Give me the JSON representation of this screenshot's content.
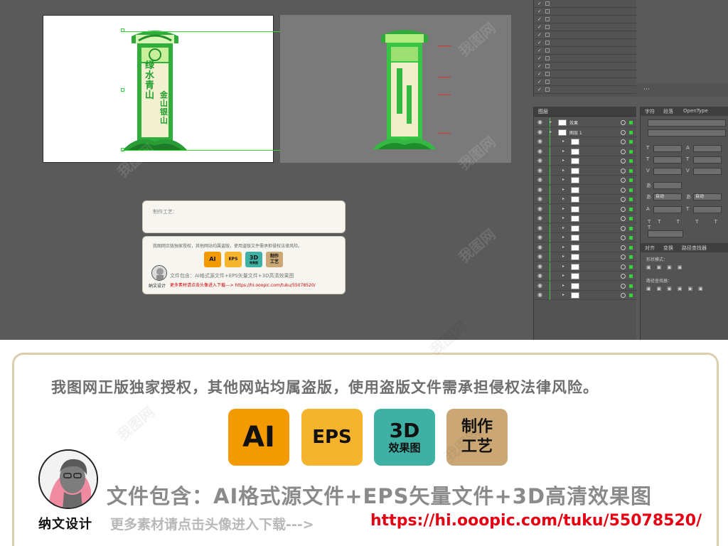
{
  "artboard": {
    "left_sign": {
      "line1": "绿水青山",
      "line2": "金山银山"
    },
    "right_annotations": [
      "",
      "",
      "",
      ""
    ]
  },
  "preview": {
    "craft_title": "制作工艺：",
    "craft_lines": [
      "",
      "",
      ""
    ],
    "promo_notice": "我图网正版独家授权，其他网站均属盗版，使用盗版文件需承担侵权法律风险。",
    "badges": [
      "AI",
      "EPS",
      "3D",
      "效果图",
      "制作",
      "工艺"
    ],
    "includes": "文件包含：AI格式源文件+EPS矢量文件+3D高清效果图",
    "author": "纳文设计",
    "more": "更多素材请点击头像进入下载---> https://hi.ooopic.com/tuku/55078520/"
  },
  "layers_top": {
    "rows": [
      "",
      "",
      "",
      "",
      "",
      "",
      "",
      "",
      "",
      "",
      "",
      ""
    ]
  },
  "layers_panel": {
    "tab": "图层",
    "rows": [
      "效果",
      "图层 1",
      "",
      "",
      "",
      "",
      "",
      "",
      "",
      "",
      "",
      "",
      "",
      "",
      "",
      "",
      "",
      "",
      ""
    ]
  },
  "properties": {
    "tab_char": "字符",
    "tab_para": "段落",
    "tab_opentype": "OpenType",
    "size_value": "",
    "leading_value": "",
    "auto_label": "自动",
    "mode_label": "",
    "tab_align": "对齐",
    "tab_transform": "变换",
    "tab_pathfinder": "路径查找器",
    "mode_label2": "形状模式：",
    "pathfinder_label": "路径查找器："
  },
  "banner": {
    "notice": "我图网正版独家授权，其他网站均属盗版，使用盗版文件需承担侵权法律风险。",
    "badge_ai": "AI",
    "badge_eps": "EPS",
    "badge_3d_big": "3D",
    "badge_3d_small": "效果图",
    "badge_craft_1": "制作",
    "badge_craft_2": "工艺",
    "includes": "文件包含：AI格式源文件+EPS矢量文件+3D高清效果图",
    "designer": "纳文设计",
    "more": "更多素材请点击头像进入下载--->",
    "url": "https://hi.ooopic.com/tuku/55078520/"
  },
  "watermark": "我图网",
  "colors": {
    "ai": "#f29a00",
    "eps": "#f6b32e",
    "threed": "#3fb0a4",
    "craft": "#caa774",
    "selection": "#36d13c",
    "sign_green": "#1f9e2c",
    "link": "#e60012"
  }
}
